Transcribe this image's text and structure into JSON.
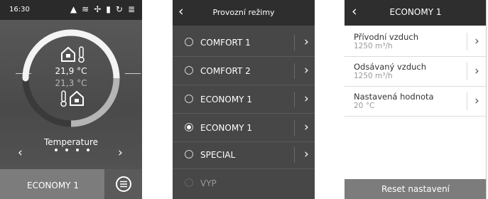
{
  "screen1": {
    "time": "16:30",
    "status_icons": [
      "warning-icon",
      "heating-icon",
      "fan-icon",
      "filter-icon",
      "sync-icon",
      "defrost-icon"
    ],
    "temp_supply": "21,9 °C",
    "temp_extract": "21,3 °C",
    "page_label": "Temperature",
    "page_count": 4,
    "current_page": 1,
    "mode_button": "ECONOMY 1",
    "menu_icon": "menu-icon"
  },
  "screen2": {
    "title": "Provozní režimy",
    "modes": [
      {
        "label": "COMFORT 1",
        "selected": false,
        "has_chevron": true
      },
      {
        "label": "COMFORT 2",
        "selected": false,
        "has_chevron": true
      },
      {
        "label": "ECONOMY 1",
        "selected": false,
        "has_chevron": true
      },
      {
        "label": "ECONOMY 1",
        "selected": true,
        "has_chevron": true
      },
      {
        "label": "SPECIAL",
        "selected": false,
        "has_chevron": true
      },
      {
        "label": "VYP",
        "selected": false,
        "has_chevron": false
      }
    ]
  },
  "screen3": {
    "title": "ECONOMY 1",
    "items": [
      {
        "label": "Přívodní vzduch",
        "value": "1250 m³/h"
      },
      {
        "label": "Odsávaný vzduch",
        "value": "1250 m³/h"
      },
      {
        "label": "Nastavená hodnota",
        "value": "20 °C"
      }
    ],
    "reset_button": "Reset nastavení"
  }
}
